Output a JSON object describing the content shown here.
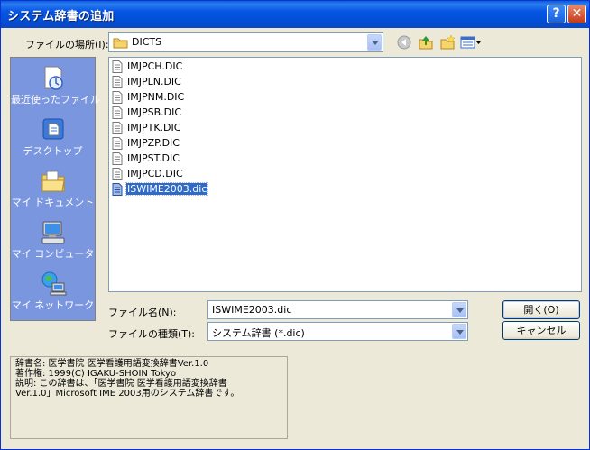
{
  "window": {
    "title": "システム辞書の追加"
  },
  "titlebar": {
    "help_glyph": "?",
    "close_glyph": "✕"
  },
  "lookin": {
    "label": "ファイルの場所(I):",
    "value": "DICTS"
  },
  "places": [
    {
      "label": "最近使ったファイル",
      "icon": "recent-documents-icon"
    },
    {
      "label": "デスクトップ",
      "icon": "desktop-icon"
    },
    {
      "label": "マイ ドキュメント",
      "icon": "my-documents-icon"
    },
    {
      "label": "マイ コンピュータ",
      "icon": "my-computer-icon"
    },
    {
      "label": "マイ ネットワーク",
      "icon": "my-network-icon"
    }
  ],
  "files": [
    {
      "name": "IMJPCH.DIC",
      "selected": false
    },
    {
      "name": "IMJPLN.DIC",
      "selected": false
    },
    {
      "name": "IMJPNM.DIC",
      "selected": false
    },
    {
      "name": "IMJPSB.DIC",
      "selected": false
    },
    {
      "name": "IMJPTK.DIC",
      "selected": false
    },
    {
      "name": "IMJPZP.DIC",
      "selected": false
    },
    {
      "name": "IMJPST.DIC",
      "selected": false
    },
    {
      "name": "IMJPCD.DIC",
      "selected": false
    },
    {
      "name": "ISWIME2003.dic",
      "selected": true
    }
  ],
  "filename": {
    "label": "ファイル名(N):",
    "value": "ISWIME2003.dic"
  },
  "filetype": {
    "label": "ファイルの種類(T):",
    "value": "システム辞書 (*.dic)"
  },
  "buttons": {
    "open": "開く(O)",
    "cancel": "キャンセル"
  },
  "description": {
    "lines": [
      "辞書名: 医学書院 医学看護用語変換辞書Ver.1.0",
      "著作権: 1999(C) IGAKU-SHOIN Tokyo",
      "説明: この辞書は、「医学書院 医学看護用語変換辞書",
      "Ver.1.0」Microsoft IME 2003用のシステム辞書です。"
    ]
  },
  "colors": {
    "titlebar": "#0554e3",
    "places_bg": "#7a96df",
    "selection": "#316ac5",
    "dialog_bg": "#ece9d8"
  }
}
